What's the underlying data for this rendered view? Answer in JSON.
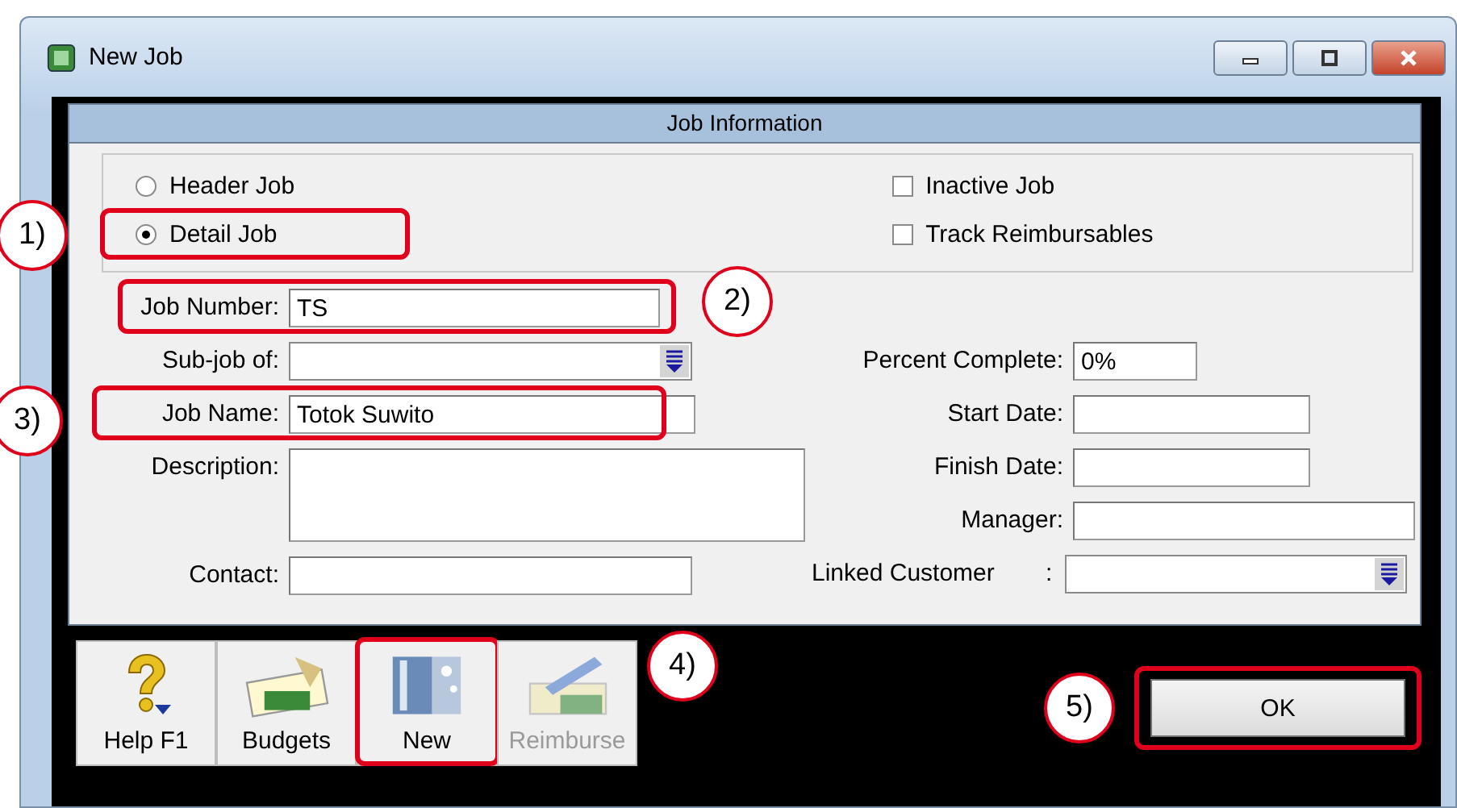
{
  "window": {
    "title": "New Job"
  },
  "section": {
    "title": "Job Information"
  },
  "job_type": [
    {
      "label": "Header Job",
      "selected": false,
      "highlighted": false
    },
    {
      "label": "Detail Job",
      "selected": true,
      "highlighted": true,
      "callout": "1)"
    }
  ],
  "options": [
    {
      "label": "Inactive Job",
      "checked": false
    },
    {
      "label": "Track Reimbursables",
      "checked": false
    }
  ],
  "fields_left": [
    {
      "label": "Job Number:",
      "value": "TS",
      "kind": "text",
      "highlighted": true,
      "callout": "2)"
    },
    {
      "label": "Sub-job of:",
      "kind": "dropdown",
      "highlighted": false
    },
    {
      "label": "Job Name:",
      "value": "Totok Suwito",
      "kind": "text",
      "highlighted": true,
      "callout": "3)"
    },
    {
      "label": "Description:",
      "kind": "textarea",
      "highlighted": false
    },
    {
      "label": "Contact:",
      "kind": "text",
      "highlighted": false
    }
  ],
  "fields_right": [
    {
      "label": "Percent Complete:",
      "value": "0%",
      "kind": "short"
    },
    {
      "label": "Start Date:",
      "kind": "date"
    },
    {
      "label": "Finish Date:",
      "kind": "date"
    },
    {
      "label": "Manager:",
      "kind": "text"
    },
    {
      "label": "Linked Customer",
      "separator": ":",
      "kind": "dropdown"
    }
  ],
  "toolbar": [
    {
      "label": "Help F1",
      "kind": "help",
      "disabled": false,
      "highlighted": false
    },
    {
      "label": "Budgets",
      "kind": "budgets",
      "disabled": false,
      "highlighted": false
    },
    {
      "label": "New",
      "kind": "new",
      "disabled": false,
      "highlighted": true,
      "callout": "4)"
    },
    {
      "label": "Reimburse",
      "kind": "reimburse",
      "disabled": true,
      "highlighted": false
    }
  ],
  "ok_button": {
    "label": "OK",
    "highlighted": true,
    "callout": "5)"
  }
}
